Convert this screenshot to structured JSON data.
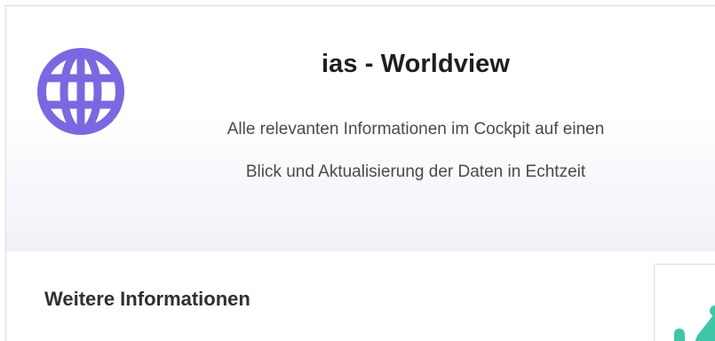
{
  "header": {
    "title": "ias - Worldview",
    "subtitle_line1": "Alle relevanten Informationen im Cockpit auf einen",
    "subtitle_line2": "Blick und Aktualisierung der Daten in Echtzeit",
    "icon": "globe-icon",
    "icon_color": "#7b68e0"
  },
  "main": {
    "section_title": "Weitere Informationen"
  },
  "side_card": {
    "icon": "chart-icon",
    "accent_color": "#3fc5a8"
  }
}
